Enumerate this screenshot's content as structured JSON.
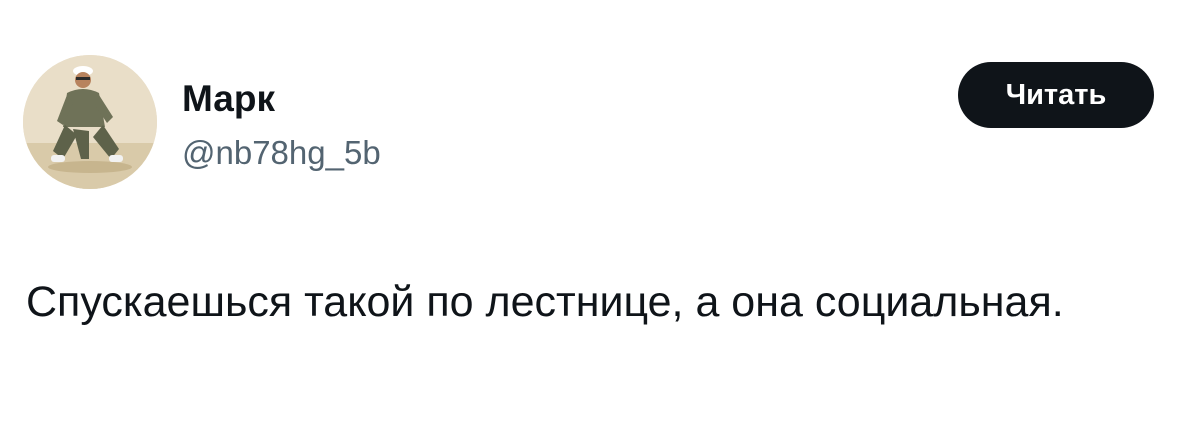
{
  "author": {
    "display_name": "Марк",
    "handle": "@nb78hg_5b",
    "avatar_icon": "user-avatar-photo"
  },
  "follow_button": {
    "label": "Читать"
  },
  "tweet": {
    "text": "Спускаешься такой по лестнице, а она социальная."
  },
  "colors": {
    "text_primary": "#0f1419",
    "text_secondary": "#536471",
    "button_bg": "#0f1419",
    "button_text": "#ffffff",
    "background": "#ffffff"
  }
}
